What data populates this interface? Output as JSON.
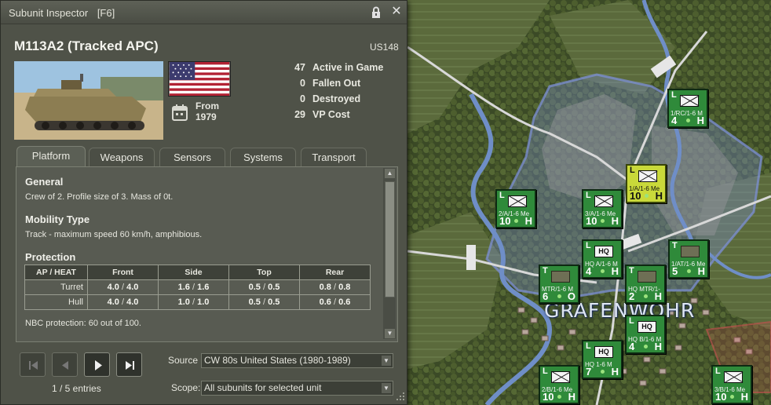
{
  "window": {
    "title": "Subunit Inspector",
    "hotkey": "[F6]",
    "lock_icon": "lock-icon",
    "close_icon": "close-icon",
    "close_glyph": "✕"
  },
  "unit": {
    "name": "M113A2 (Tracked APC)",
    "code": "US148",
    "from_label": "From",
    "from_year": "1979"
  },
  "stats": [
    {
      "value": "47",
      "label": "Active in Game"
    },
    {
      "value": "0",
      "label": "Fallen Out"
    },
    {
      "value": "0",
      "label": "Destroyed"
    },
    {
      "value": "29",
      "label": "VP Cost"
    }
  ],
  "tabs": [
    {
      "label": "Platform",
      "active": true
    },
    {
      "label": "Weapons",
      "active": false
    },
    {
      "label": "Sensors",
      "active": false
    },
    {
      "label": "Systems",
      "active": false
    },
    {
      "label": "Transport",
      "active": false
    }
  ],
  "platform": {
    "general_title": "General",
    "general_text": "Crew of 2. Profile size of 3. Mass of 0t.",
    "mobility_title": "Mobility Type",
    "mobility_text": "Track - maximum speed 60 km/h, amphibious.",
    "protection_title": "Protection",
    "protection_headers": [
      "AP / HEAT",
      "Front",
      "Side",
      "Top",
      "Rear"
    ],
    "protection_rows": [
      {
        "label": "Turret",
        "front": [
          "4.0",
          "4.0"
        ],
        "side": [
          "1.6",
          "1.6"
        ],
        "top": [
          "0.5",
          "0.5"
        ],
        "rear": [
          "0.8",
          "0.8"
        ]
      },
      {
        "label": "Hull",
        "front": [
          "4.0",
          "4.0"
        ],
        "side": [
          "1.0",
          "1.0"
        ],
        "top": [
          "0.5",
          "0.5"
        ],
        "rear": [
          "0.6",
          "0.6"
        ]
      }
    ],
    "nbc_text": "NBC protection: 60 out of 100."
  },
  "navigation": {
    "entries_text": "1 / 5 entries",
    "first_icon": "skip-first-icon",
    "prev_icon": "previous-icon",
    "play_icon": "play-icon",
    "last_icon": "skip-last-icon"
  },
  "source": {
    "label": "Source",
    "value": "CW 80s United States (1980-1989)"
  },
  "scope": {
    "label": "Scope:",
    "value": "All subunits for selected unit"
  },
  "map": {
    "town_label": "GRAFENWOHR",
    "units": [
      {
        "level": "L",
        "name": "1/RC/1-6 M",
        "strength": "4",
        "status": "H",
        "kind": "x",
        "selected": false
      },
      {
        "level": "L",
        "name": "1/A/1-6 Me",
        "strength": "10",
        "status": "H",
        "kind": "x",
        "selected": true
      },
      {
        "level": "L",
        "name": "2/A/1-6 Me",
        "strength": "10",
        "status": "H",
        "kind": "x",
        "selected": false
      },
      {
        "level": "L",
        "name": "3/A/1-6 Me",
        "strength": "10",
        "status": "H",
        "kind": "x",
        "selected": false
      },
      {
        "level": "L",
        "name": "HQ A/1-6 M",
        "strength": "4",
        "status": "H",
        "kind": "hq",
        "selected": false
      },
      {
        "level": "T",
        "name": "1/AT/1-6 Me",
        "strength": "5",
        "status": "H",
        "kind": "tank",
        "selected": false
      },
      {
        "level": "T",
        "name": "MTR/1-6 M",
        "strength": "6",
        "status": "O",
        "kind": "tank",
        "selected": false
      },
      {
        "level": "T",
        "name": "HQ MTR/1-",
        "strength": "2",
        "status": "H",
        "kind": "tank",
        "selected": false
      },
      {
        "level": "L",
        "name": "HQ B/1-6 M",
        "strength": "4",
        "status": "H",
        "kind": "hq",
        "selected": false
      },
      {
        "level": "L",
        "name": "HQ 1-6 M",
        "strength": "7",
        "status": "H",
        "kind": "hq",
        "selected": false
      },
      {
        "level": "L",
        "name": "2/B/1-6 Me",
        "strength": "10",
        "status": "H",
        "kind": "x",
        "selected": false
      },
      {
        "level": "L",
        "name": "3/B/1-6 Me",
        "strength": "10",
        "status": "H",
        "kind": "x",
        "selected": false
      }
    ]
  },
  "colors": {
    "panel_bg": "#4f5248",
    "unit_green": "#2f8a3a",
    "unit_selected": "#c9d93a",
    "hex_overlay": "#7c8fd4"
  }
}
